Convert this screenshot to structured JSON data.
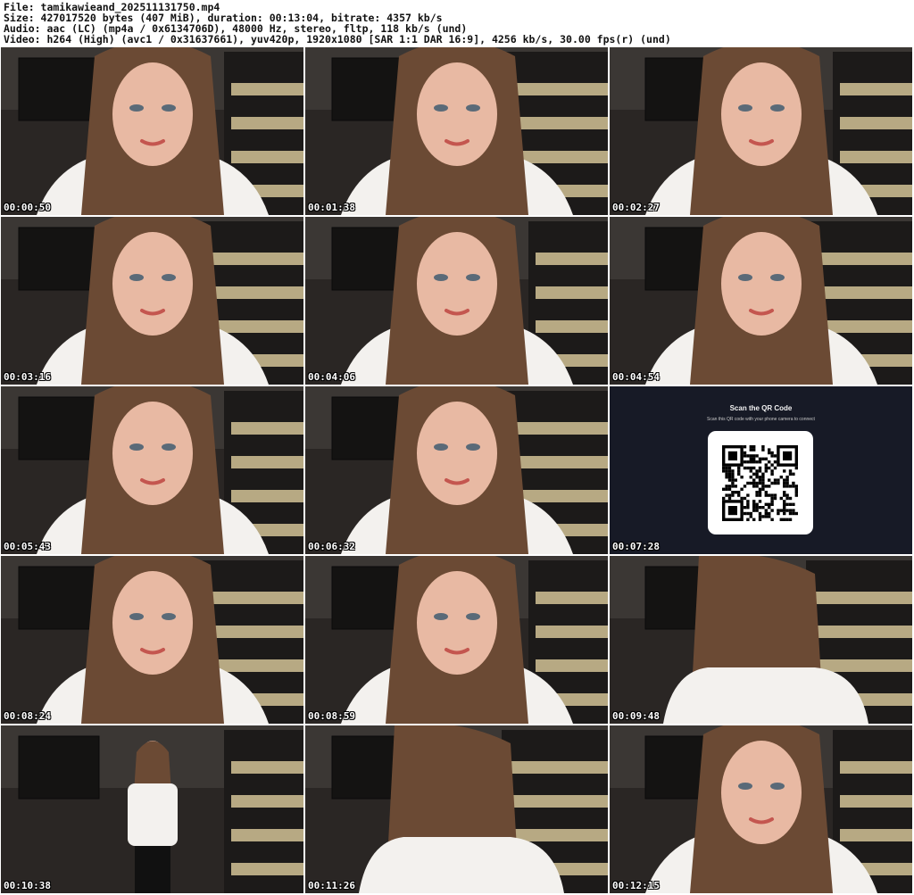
{
  "header": {
    "file_line": "File: tamikawieand_202511131750.mp4",
    "size_line": "Size: 427017520 bytes (407 MiB), duration: 00:13:04, bitrate: 4357 kb/s",
    "audio_line": "Audio: aac (LC) (mp4a / 0x6134706D), 48000 Hz, stereo, fltp, 118 kb/s (und)",
    "video_line": "Video: h264 (High) (avc1 / 0x31637661), yuv420p, 1920x1080 [SAR 1:1 DAR 16:9], 4256 kb/s, 30.00 fps(r) (und)"
  },
  "thumbnails": [
    {
      "timestamp": "00:00:50",
      "scene": "portrait"
    },
    {
      "timestamp": "00:01:38",
      "scene": "portrait"
    },
    {
      "timestamp": "00:02:27",
      "scene": "portrait"
    },
    {
      "timestamp": "00:03:16",
      "scene": "portrait"
    },
    {
      "timestamp": "00:04:06",
      "scene": "portrait"
    },
    {
      "timestamp": "00:04:54",
      "scene": "portrait"
    },
    {
      "timestamp": "00:05:43",
      "scene": "portrait"
    },
    {
      "timestamp": "00:06:32",
      "scene": "portrait"
    },
    {
      "timestamp": "00:07:28",
      "scene": "qr-screen"
    },
    {
      "timestamp": "00:08:24",
      "scene": "portrait"
    },
    {
      "timestamp": "00:08:59",
      "scene": "portrait"
    },
    {
      "timestamp": "00:09:48",
      "scene": "hair-back"
    },
    {
      "timestamp": "00:10:38",
      "scene": "full-body"
    },
    {
      "timestamp": "00:11:26",
      "scene": "hair-back"
    },
    {
      "timestamp": "00:12:15",
      "scene": "portrait"
    }
  ],
  "qr_screen": {
    "title": "Scan the QR Code",
    "subtitle": "Scan this QR code with your phone camera to connect"
  },
  "colors": {
    "room_dark": "#2a2624",
    "wall": "#3b3734",
    "cabinet_stripe": "#c9b98f",
    "hair": "#6b4a34",
    "skin": "#e8b9a3",
    "shirt": "#f3f1ee",
    "qr_bg": "#171a26"
  }
}
